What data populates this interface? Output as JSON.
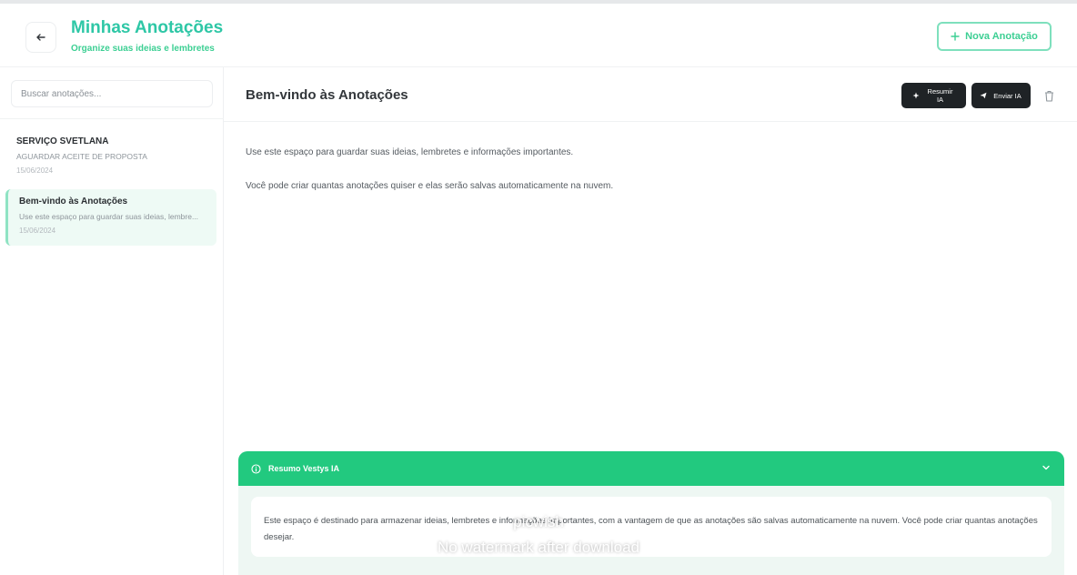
{
  "header": {
    "title": "Minhas Anotações",
    "subtitle": "Organize suas ideias e lembretes",
    "new_button_label": "Nova Anotação",
    "back_icon": "arrow-left-icon",
    "plus_icon": "plus-icon"
  },
  "colors": {
    "accent": "#2ec7a6",
    "green_bar": "#22c97f",
    "dark_button": "#1f2326"
  },
  "sidebar": {
    "search_placeholder": "Buscar anotações...",
    "notes": [
      {
        "title": "SERVIÇO SVETLANA",
        "preview": "AGUARDAR ACEITE DE PROPOSTA",
        "date": "15/06/2024",
        "active": false
      },
      {
        "title": "Bem-vindo às Anotações",
        "preview": "Use este espaço para guardar suas ideias, lembre...",
        "date": "15/06/2024",
        "active": true
      }
    ]
  },
  "main": {
    "title": "Bem-vindo às Anotações",
    "actions": {
      "first_label": "Resumir IA",
      "first_icon": "sparkle-icon",
      "second_label": "Enviar IA",
      "second_icon": "send-icon",
      "delete_icon": "trash-icon"
    },
    "paragraphs": [
      "Use este espaço para guardar suas ideias, lembretes e informações importantes.",
      "Você pode criar quantas anotações quiser e elas serão salvas automaticamente na nuvem."
    ],
    "ai_summary": {
      "header_label": "Resumo Vestys IA",
      "header_icon": "info-circle-icon",
      "collapse_icon": "chevron-down-icon",
      "text": "Este espaço é destinado para armazenar ideias, lembretes e informações importantes, com a vantagem de que as anotações são salvas automaticamente na nuvem. Você pode criar quantas anotações desejar."
    }
  },
  "watermark": {
    "line1": "picwish",
    "line2": "No watermark after download"
  }
}
